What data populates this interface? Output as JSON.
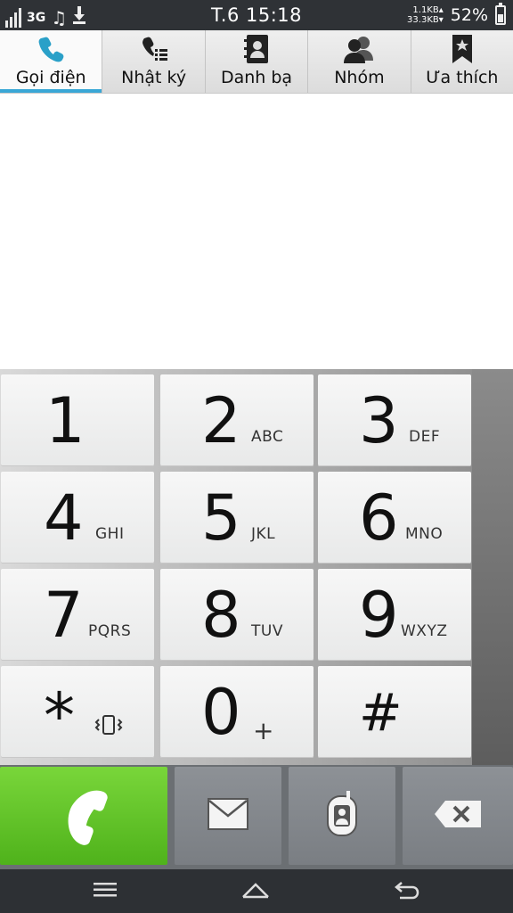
{
  "status_bar": {
    "network": "3G",
    "time": "T.6 15:18",
    "upload_speed": "1.1KB",
    "download_speed": "33.3KB",
    "battery_percent": "52%",
    "battery_level": 0.52,
    "icons": [
      "signal-icon",
      "music-icon",
      "download-icon",
      "battery-icon"
    ]
  },
  "tabs": [
    {
      "label": "Gọi điện",
      "icon": "phone-icon",
      "active": true
    },
    {
      "label": "Nhật ký",
      "icon": "call-log-icon",
      "active": false
    },
    {
      "label": "Danh bạ",
      "icon": "contacts-book-icon",
      "active": false
    },
    {
      "label": "Nhóm",
      "icon": "group-icon",
      "active": false
    },
    {
      "label": "Ưa thích",
      "icon": "favorite-bookmark-icon",
      "active": false
    }
  ],
  "keypad": {
    "keys": [
      {
        "digit": "1",
        "letters": ""
      },
      {
        "digit": "2",
        "letters": "ABC"
      },
      {
        "digit": "3",
        "letters": "DEF"
      },
      {
        "digit": "4",
        "letters": "GHI"
      },
      {
        "digit": "5",
        "letters": "JKL"
      },
      {
        "digit": "6",
        "letters": "MNO"
      },
      {
        "digit": "7",
        "letters": "PQRS"
      },
      {
        "digit": "8",
        "letters": "TUV"
      },
      {
        "digit": "9",
        "letters": "WXYZ"
      },
      {
        "digit": "*",
        "letters": ""
      },
      {
        "digit": "0",
        "letters": "+"
      },
      {
        "digit": "#",
        "letters": ""
      }
    ]
  },
  "actions": {
    "call_icon": "phone-handset-icon",
    "message_icon": "envelope-icon",
    "video_call_icon": "video-call-contact-icon",
    "backspace_icon": "backspace-icon",
    "call_color": "#5cc220"
  },
  "navigation": {
    "menu_icon": "menu-icon",
    "home_icon": "home-icon",
    "back_icon": "back-icon"
  },
  "colors": {
    "accent": "#3aa7d6",
    "call_green": "#5cc220",
    "status_bar": "#2f3236"
  }
}
